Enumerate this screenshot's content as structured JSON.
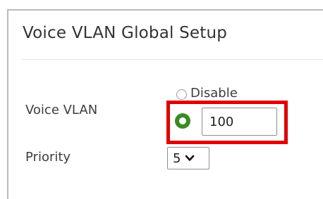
{
  "panel": {
    "title": "Voice VLAN Global Setup"
  },
  "voice_vlan": {
    "label": "Voice VLAN",
    "disable_option_label": "Disable",
    "vlan_value": "100",
    "selected_option": "vlan-id"
  },
  "priority": {
    "label": "Priority",
    "selected_value": "5"
  },
  "colors": {
    "highlight_border": "#e00000",
    "radio_selected": "#3a8a24",
    "text": "#3d3d3d"
  },
  "icons": {
    "select_arrow": "chevron-down-icon",
    "radio_selected": "radio-checked-icon",
    "radio_unselected": "radio-unchecked-icon"
  }
}
